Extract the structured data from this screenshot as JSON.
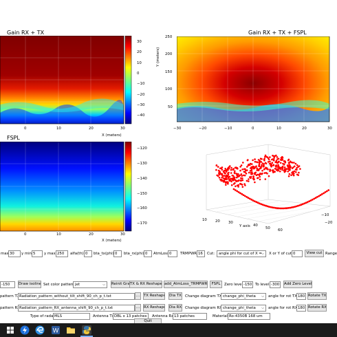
{
  "window": {
    "quit_label": "Quit"
  },
  "plots": {
    "tl": {
      "title": "Gain RX + TX",
      "xlabel": "X (meters)",
      "xticks": [
        "0",
        "10",
        "20",
        "30"
      ],
      "cbar_ticks": [
        "30",
        "20",
        "10",
        "0",
        "−10",
        "−20",
        "−30",
        "−40"
      ]
    },
    "tr": {
      "title": "Gain RX + TX + FSPL",
      "ylabel": "Y (meters)",
      "xticks": [
        "−30",
        "−20",
        "−10",
        "0",
        "10",
        "20",
        "30"
      ],
      "yticks": [
        "250",
        "200",
        "150",
        "100",
        "50"
      ]
    },
    "bl": {
      "title": "FSPL",
      "xlabel": "X (meters)",
      "xticks": [
        "0",
        "10",
        "20",
        "30"
      ],
      "cbar_ticks": [
        "−120",
        "−130",
        "−140",
        "−150",
        "−160",
        "−170"
      ]
    },
    "br": {
      "axis_label": "Y axis",
      "ticks_front": [
        "10",
        "20",
        "30",
        "40",
        "50",
        "60"
      ],
      "ticks_side": [
        "−10",
        "−20"
      ]
    }
  },
  "controls": {
    "row1": {
      "xmax_label": "max:",
      "xmax_value": "30",
      "ymin_label": "y min:",
      "ymin_value": "5",
      "ymax_label": "y max:",
      "ymax_value": "250",
      "alfa_label": "alfa(th):",
      "alfa_value": "0",
      "bta_tx_label": "bta_tx(phi):",
      "bta_tx_value": "0",
      "bta_rx_label": "bta_rx(phi):",
      "bta_rx_value": "0",
      "atmloss_label": "AtmLoss:",
      "atmloss_value": "0",
      "trmpwr_label": "TRMPWR:",
      "trmpwr_value": "16",
      "cut_label": "Cut:",
      "cut_value": "angle phi for cut of X =",
      "xory_label": "X or Y of cut:",
      "xory_value": "0",
      "viewcut_label": "View cut",
      "range_label": "Range"
    },
    "row2": {
      "isoline_value": "-150",
      "draw_isoline_label": "Draw isoline",
      "color_pattern_label": "Set color pattern:",
      "color_pattern_value": "jet",
      "reinit_label": "Reinit Graphs",
      "txrx_reshape_label": "TX & RX Reshape",
      "add_atm_label": "add_AtmLoss_TRMPWR",
      "fspl_label": "FSPL",
      "zero_level_label": "Zero level:",
      "zero_level_value": "-150",
      "to_level_label": "To level:",
      "to_level_value": "-300",
      "add_zero_label": "Add Zero Level"
    },
    "row3": {
      "label": "pattern TX:",
      "file": "Radiation_pattern_without_tilt_shift_90_ch_p_t.txt",
      "browse": "...",
      "reshape": "TX Reshape",
      "dia": "Dia TX",
      "change_label": "Change diagram TX:",
      "change_value": "change_phi_theta",
      "angle_label": "angle for rot TX:",
      "angle_value": "180",
      "rotate": "Rotate TX"
    },
    "row4": {
      "label": "pattern RX:",
      "file": "Radiation_pattern_RX_antenna_shift_90_ch_p_t.txt",
      "browse": "...",
      "reshape": "RX Reshape",
      "dia": "Dia RX",
      "change_label": "Change diagram RX:",
      "change_value": "change_phi_theta",
      "angle_label": "angle for rot RX:",
      "angle_value": "180",
      "rotate": "Rotate RX"
    },
    "row5": {
      "radar_label": "Type of radar:",
      "radar_value": "MLS",
      "antenna_tx_label": "Antenna Tx:",
      "antenna_tx_value": "DBL x 13 patches",
      "antenna_rx_label": "Antenna Rx:",
      "antenna_rx_value": "13 patches",
      "material_label": "Material:",
      "material_value": "Ro-4350B 168 um"
    }
  },
  "taskbar": {
    "icons": [
      "windows-icon",
      "app-bolt-icon",
      "edge-icon",
      "word-icon",
      "explorer-icon",
      "python-icon"
    ]
  },
  "colors": {
    "jet_dark_red": "#800000",
    "jet_dark_blue": "#00007f",
    "button_bg": "#e6e6e6",
    "taskbar_bg": "#1b1b1b",
    "scatter_red": "#ff0000"
  }
}
